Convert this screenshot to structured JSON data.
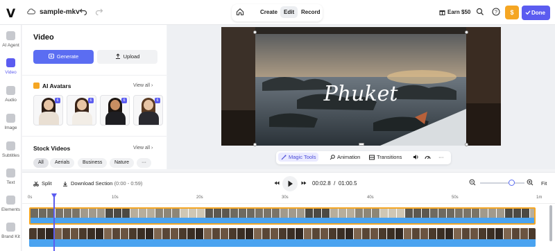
{
  "app": {
    "logo": "V",
    "project_name": "sample-mkv"
  },
  "header": {
    "modes": [
      "Create",
      "Edit",
      "Record"
    ],
    "active_mode": "Edit",
    "earn_label": "Earn $50",
    "credits_label": "$",
    "done_label": "Done"
  },
  "rail": {
    "items": [
      {
        "label": "AI Agent",
        "icon": "plus-icon"
      },
      {
        "label": "Video",
        "icon": "video-icon",
        "active": true
      },
      {
        "label": "Audio",
        "icon": "music-icon"
      },
      {
        "label": "Image",
        "icon": "image-icon"
      },
      {
        "label": "Subtitles",
        "icon": "subtitles-icon"
      },
      {
        "label": "Text",
        "icon": "text-icon"
      },
      {
        "label": "Elements",
        "icon": "elements-icon"
      },
      {
        "label": "Brand Kit",
        "icon": "brand-kit-icon"
      }
    ]
  },
  "panel": {
    "title": "Video",
    "generate_label": "Generate",
    "upload_label": "Upload",
    "avatars": {
      "title": "AI Avatars",
      "view_all": "View all",
      "tag": "6"
    },
    "stock": {
      "title": "Stock Videos",
      "view_all": "View all",
      "chips": [
        "All",
        "Aerials",
        "Business",
        "Nature"
      ],
      "more": "···"
    }
  },
  "stage": {
    "video_title_overlay": "Phuket",
    "tools": {
      "magic": "Magic Tools",
      "animation": "Animation",
      "transitions": "Transitions",
      "more": "···"
    }
  },
  "timeline": {
    "split_label": "Split",
    "download_label": "Download Section",
    "download_range": "(0:00 - 0:59)",
    "current_time": "00:02.8",
    "separator": "/",
    "total_time": "01:00.5",
    "fit_label": "Fit",
    "zoom_level": 0.72,
    "ruler": [
      "0s",
      "10s",
      "20s",
      "30s",
      "40s",
      "50s",
      "1m"
    ]
  },
  "colors": {
    "accent": "#5b5cf0",
    "credits": "#f5a623",
    "track_highlight": "#f5a623",
    "waveform": "#4aa3f0"
  }
}
